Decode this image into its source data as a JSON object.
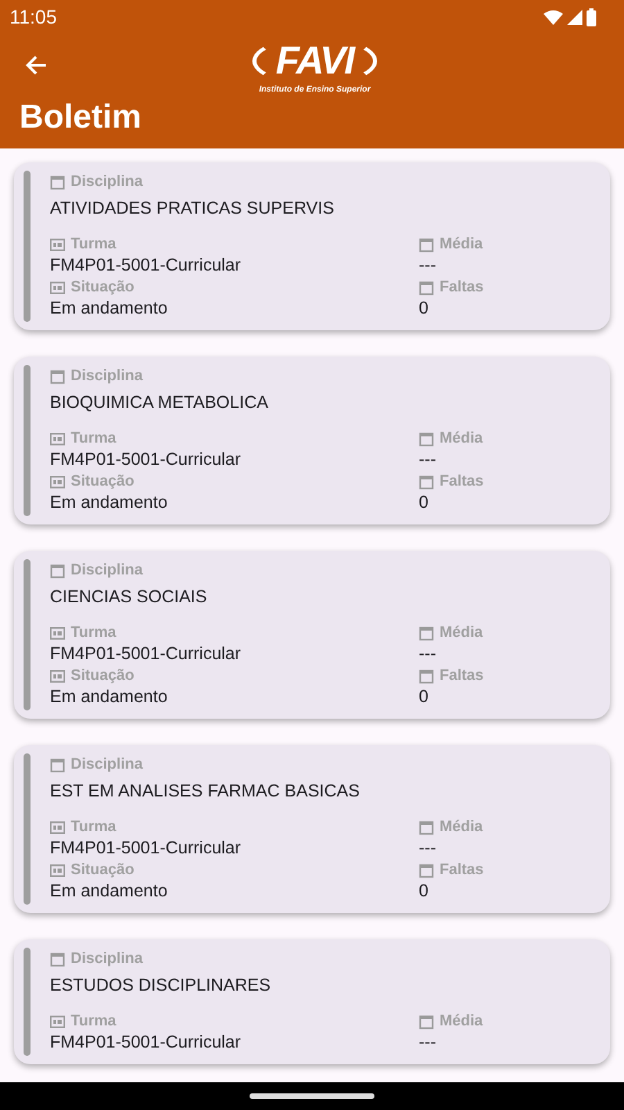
{
  "status_bar": {
    "time": "11:05"
  },
  "header": {
    "logo": {
      "mark": "FAVI",
      "tagline": "Instituto de Ensino Superior"
    },
    "title": "Boletim"
  },
  "cards": [
    {
      "disciplina_label": "Disciplina",
      "disciplina": "ATIVIDADES PRATICAS SUPERVIS",
      "turma_label": "Turma",
      "turma": "FM4P01-5001-Curricular",
      "media_label": "Média",
      "media": "---",
      "situacao_label": "Situação",
      "situacao": "Em andamento",
      "faltas_label": "Faltas",
      "faltas": "0"
    },
    {
      "disciplina_label": "Disciplina",
      "disciplina": "BIOQUIMICA METABOLICA",
      "turma_label": "Turma",
      "turma": "FM4P01-5001-Curricular",
      "media_label": "Média",
      "media": "---",
      "situacao_label": "Situação",
      "situacao": "Em andamento",
      "faltas_label": "Faltas",
      "faltas": "0"
    },
    {
      "disciplina_label": "Disciplina",
      "disciplina": "CIENCIAS SOCIAIS",
      "turma_label": "Turma",
      "turma": "FM4P01-5001-Curricular",
      "media_label": "Média",
      "media": "---",
      "situacao_label": "Situação",
      "situacao": "Em andamento",
      "faltas_label": "Faltas",
      "faltas": "0"
    },
    {
      "disciplina_label": "Disciplina",
      "disciplina": "EST EM ANALISES FARMAC BASICAS",
      "turma_label": "Turma",
      "turma": "FM4P01-5001-Curricular",
      "media_label": "Média",
      "media": "---",
      "situacao_label": "Situação",
      "situacao": "Em andamento",
      "faltas_label": "Faltas",
      "faltas": "0"
    },
    {
      "disciplina_label": "Disciplina",
      "disciplina": "ESTUDOS DISCIPLINARES",
      "turma_label": "Turma",
      "turma": "FM4P01-5001-Curricular",
      "media_label": "Média",
      "media": "---"
    }
  ]
}
